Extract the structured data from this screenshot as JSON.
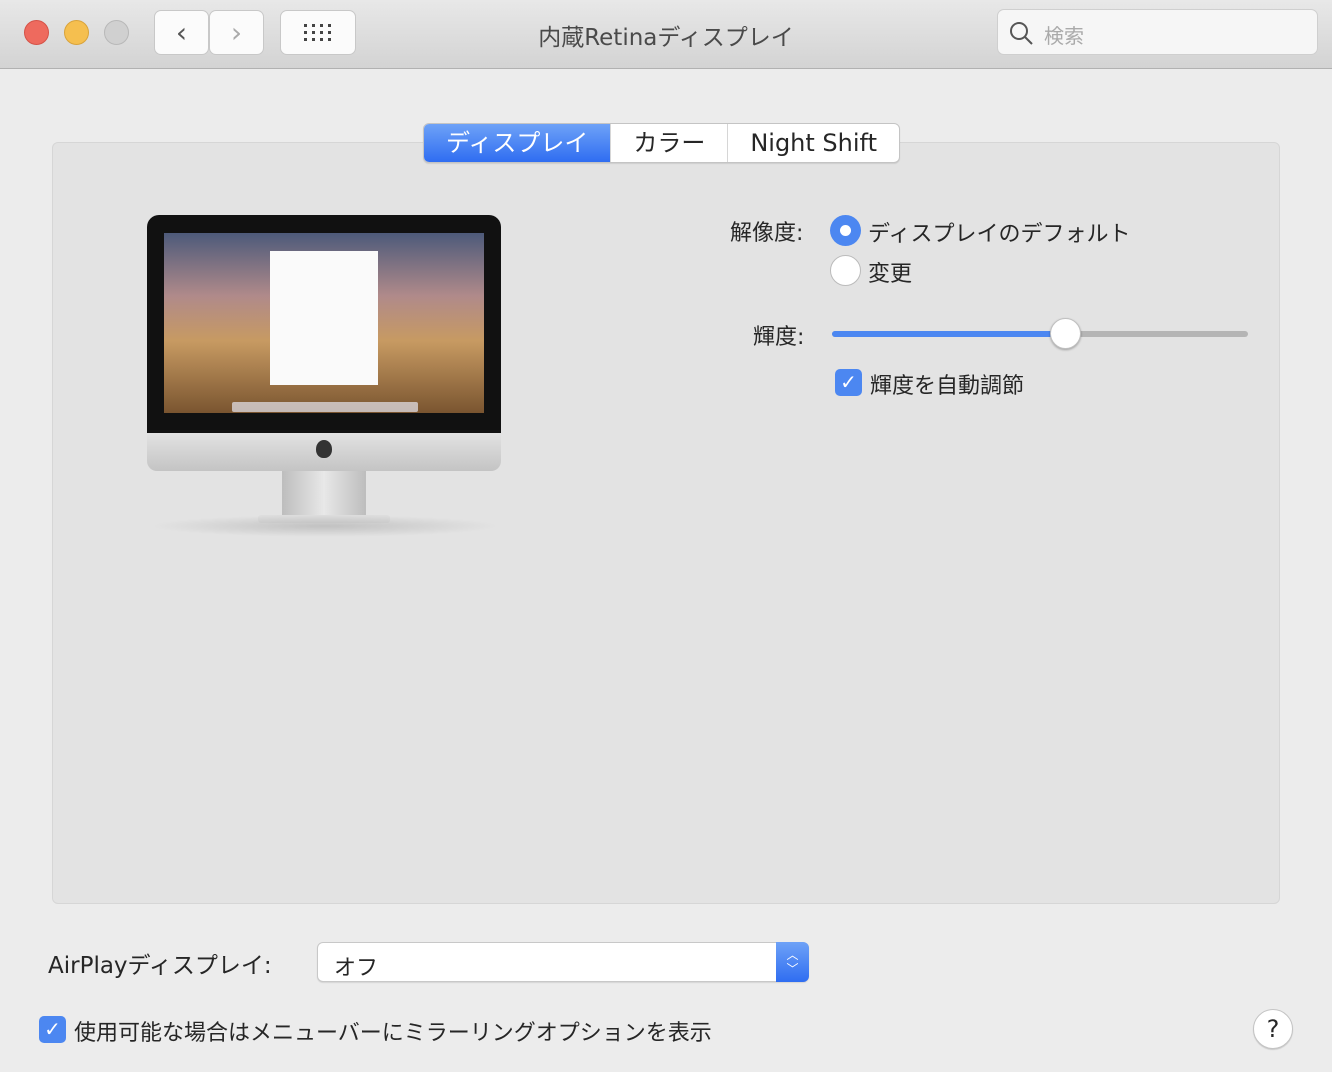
{
  "window": {
    "title": "内蔵Retinaディスプレイ",
    "search_placeholder": "検索"
  },
  "tabs": [
    {
      "label": "ディスプレイ",
      "active": true
    },
    {
      "label": "カラー",
      "active": false
    },
    {
      "label": "Night Shift",
      "active": false
    }
  ],
  "resolution": {
    "label": "解像度:",
    "options": [
      {
        "label": "ディスプレイのデフォルト",
        "selected": true
      },
      {
        "label": "変更",
        "selected": false
      }
    ]
  },
  "brightness": {
    "label": "輝度:",
    "value": 0.56,
    "auto_label": "輝度を自動調節",
    "auto_checked": true
  },
  "airplay": {
    "label": "AirPlayディスプレイ:",
    "value": "オフ"
  },
  "mirroring": {
    "label": "使用可能な場合はメニューバーにミラーリングオプションを表示",
    "checked": true
  },
  "help": "?",
  "colors": {
    "accent": "#4c87f1",
    "close": "#ee6a5e",
    "minimize": "#f5bf4f"
  }
}
